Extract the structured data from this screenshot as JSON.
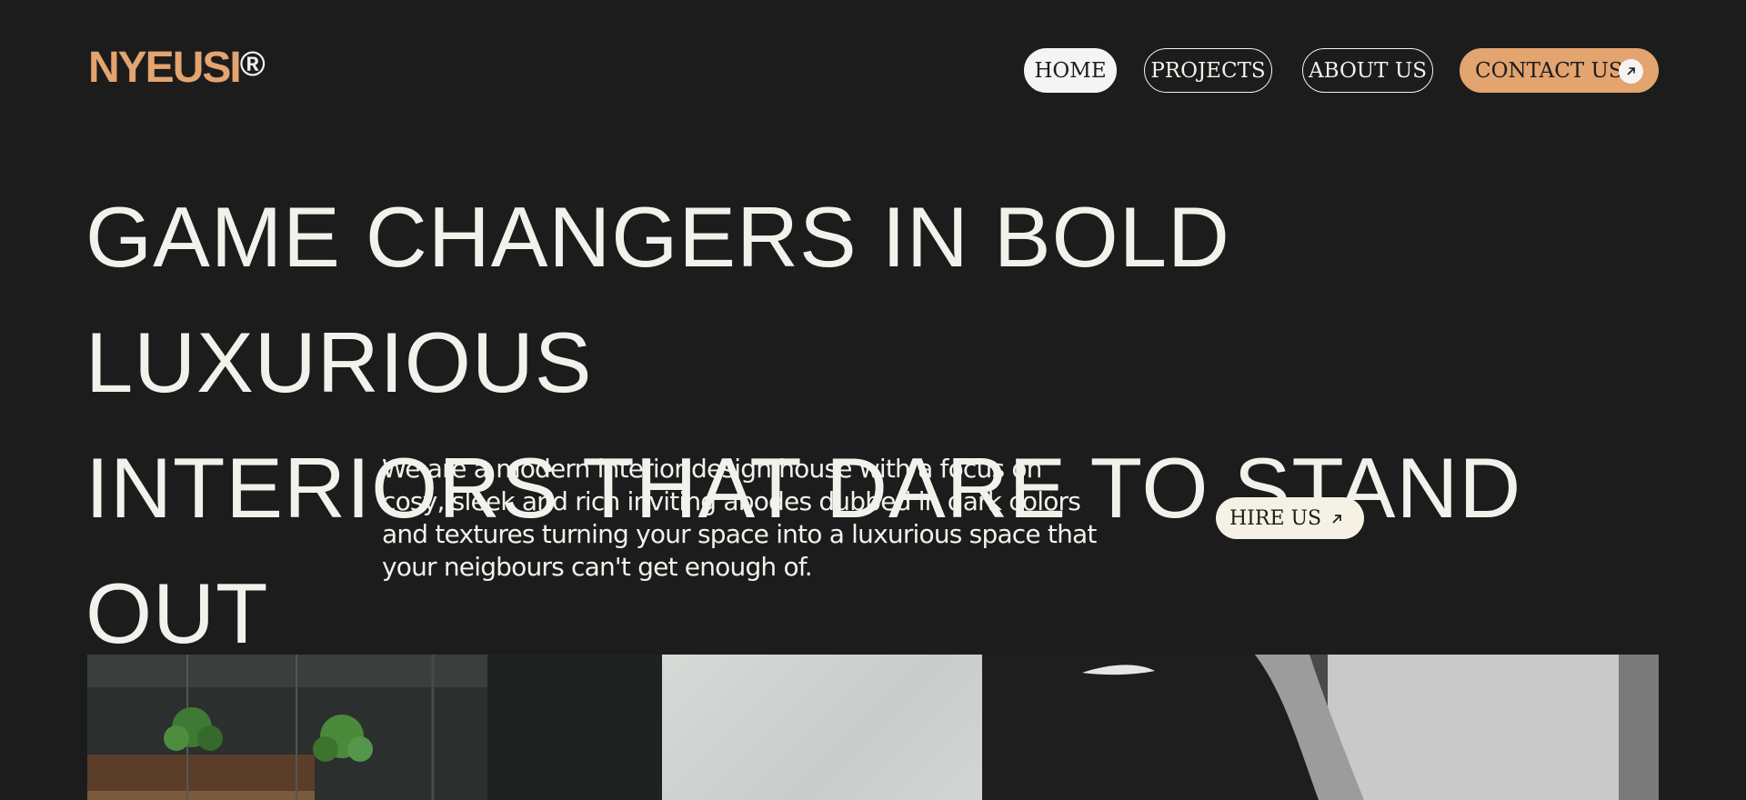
{
  "brand": {
    "name": "NYEUSI",
    "mark": "®"
  },
  "nav": {
    "items": [
      {
        "label": "HOME",
        "active": true
      },
      {
        "label": "PROJECTS",
        "active": false
      },
      {
        "label": "ABOUT US",
        "active": false
      },
      {
        "label": "CONTACT US",
        "active": false
      }
    ]
  },
  "hero": {
    "headline_line1": "GAME CHANGERS IN BOLD LUXURIOUS",
    "headline_line2": "INTERIORS THAT DARE TO STAND OUT",
    "intro": "We are a modern interior design house with a focus on cosy, sleek and rich inviting abodes dubbed in dark colors and textures turning your space into a luxurious space that your neigbours can't get enough of.",
    "cta_label": "HIRE US"
  },
  "gallery": {
    "images": [
      {
        "name": "kitchen-image",
        "icon": "dark-kitchen-with-plants"
      },
      {
        "name": "wall-texture-image",
        "icon": "white-textured-wall"
      },
      {
        "name": "portrait-image",
        "icon": "bw-profile-portrait"
      }
    ]
  },
  "colors": {
    "background": "#1c1c1c",
    "accent": "#e3a46f",
    "text": "#f3f1ec",
    "cta_bg": "#f5f1e4"
  }
}
